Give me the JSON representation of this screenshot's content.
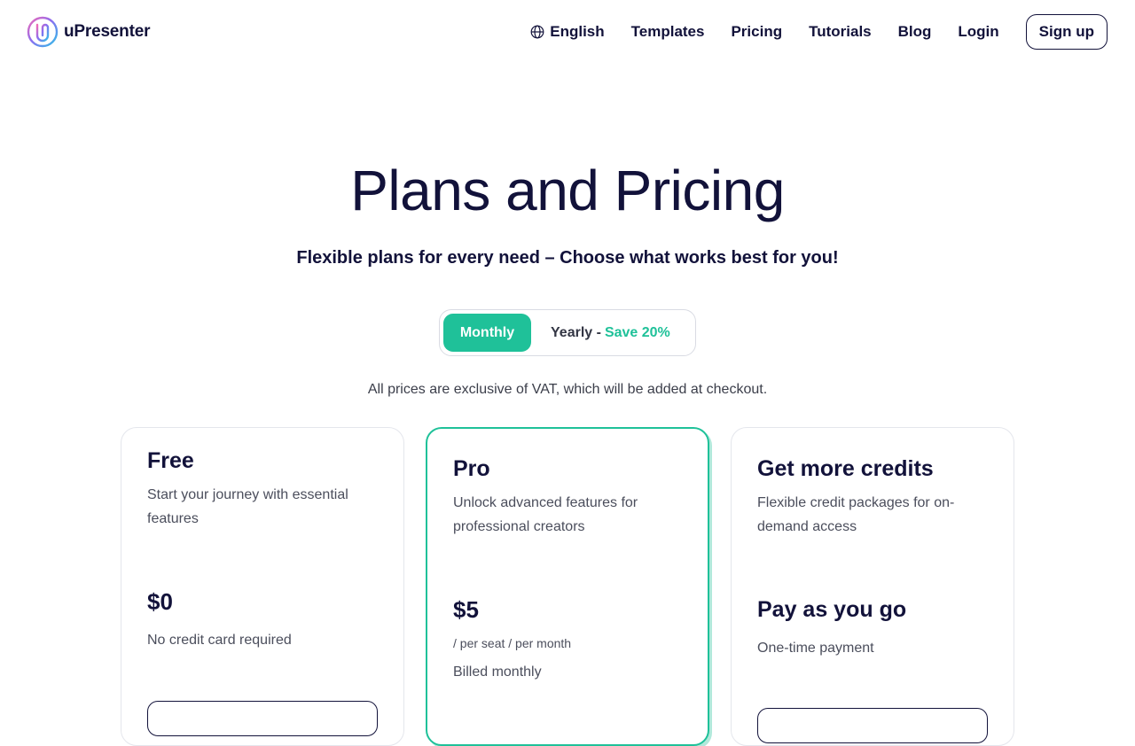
{
  "header": {
    "brand": "uPresenter",
    "nav": [
      {
        "label": "English",
        "icon": "globe-icon"
      },
      {
        "label": "Templates"
      },
      {
        "label": "Pricing"
      },
      {
        "label": "Tutorials"
      },
      {
        "label": "Blog"
      },
      {
        "label": "Login"
      }
    ],
    "signup_label": "Sign up"
  },
  "hero": {
    "title": "Plans and Pricing",
    "subtitle": "Flexible plans for every need – Choose what works best for you!"
  },
  "billing_toggle": {
    "monthly_label": "Monthly",
    "yearly_label": "Yearly -",
    "yearly_save": "Save 20%",
    "selected": "Monthly"
  },
  "vat_note": "All prices are exclusive of VAT, which will be added at checkout.",
  "plans": [
    {
      "name": "Free",
      "description": "Start your journey with essential features",
      "price": "$0",
      "note": "No credit card required"
    },
    {
      "name": "Pro",
      "description": "Unlock advanced features for professional creators",
      "price": "$5",
      "unit": "/ per seat / per month",
      "note": "Billed monthly"
    },
    {
      "name": "Get more credits",
      "description": "Flexible credit packages for on-demand access",
      "price": "Pay as you go",
      "note": "One-time payment"
    }
  ],
  "colors": {
    "accent": "#1fc199",
    "text": "#12123a",
    "muted": "#4b4e5c",
    "border": "#e4e6ec"
  }
}
